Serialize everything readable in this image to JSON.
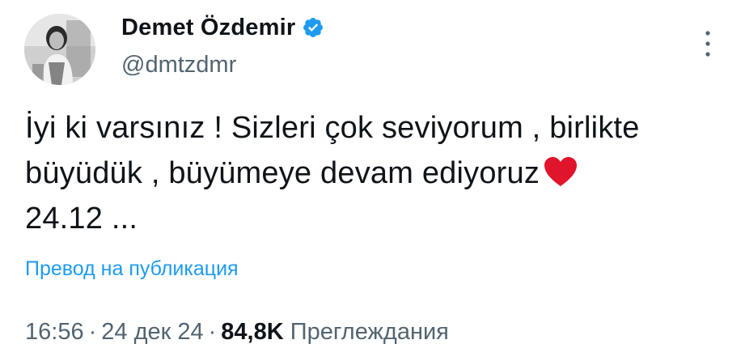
{
  "author": {
    "name": "Demet Özdemir",
    "handle": "@dmtzdmr",
    "verified": true,
    "verified_icon": "verified-badge-icon",
    "verified_color": "#1d9bf0"
  },
  "menu": {
    "icon": "more-vertical-icon"
  },
  "tweet": {
    "line1": "İyi ki varsınız ! Sizleri çok seviyorum , birlikte",
    "line2": "büyüdük , büyümeye devam ediyoruz",
    "heart_icon": "red-heart-emoji",
    "heart_color": "#e0142a",
    "line3": "24.12 ..."
  },
  "translate_label": "Превод на публикация",
  "meta": {
    "time": "16:56",
    "date": "24 дек 24",
    "separator": "·",
    "views_count": "84,8K",
    "views_label": "Преглеждания"
  },
  "colors": {
    "text": "#0f1419",
    "secondary": "#536471",
    "link": "#1d9bf0"
  }
}
